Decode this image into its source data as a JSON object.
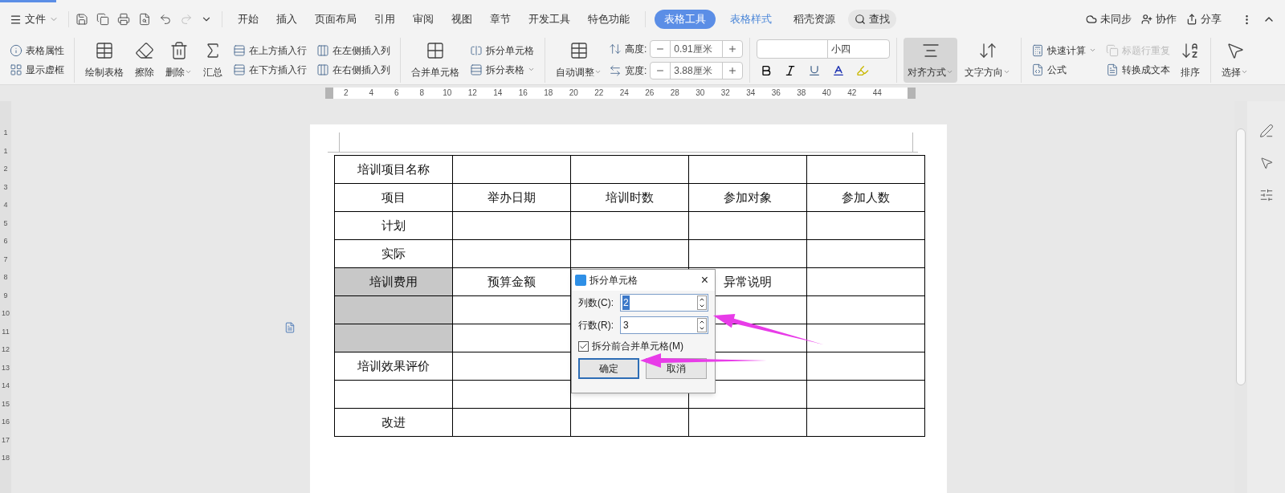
{
  "menu": {
    "file": "文件",
    "tabs": [
      {
        "label": "开始",
        "selected": false
      },
      {
        "label": "插入",
        "selected": false
      },
      {
        "label": "页面布局",
        "selected": false
      },
      {
        "label": "引用",
        "selected": false
      },
      {
        "label": "审阅",
        "selected": false
      },
      {
        "label": "视图",
        "selected": false
      },
      {
        "label": "章节",
        "selected": false
      },
      {
        "label": "开发工具",
        "selected": false
      },
      {
        "label": "特色功能",
        "selected": false
      }
    ],
    "context_tabs": [
      {
        "label": "表格工具",
        "selected": true
      },
      {
        "label": "表格样式",
        "selected": false
      }
    ],
    "extra_tab": "稻壳资源",
    "search": "查找",
    "sync": "未同步",
    "collab": "协作",
    "share": "分享"
  },
  "ribbon": {
    "table_props": "表格属性",
    "show_grid": "显示虚框",
    "draw_table": "绘制表格",
    "erase": "擦除",
    "delete": "删除",
    "summary": "汇总",
    "insert_above": "在上方插入行",
    "insert_below": "在下方插入行",
    "insert_left": "在左侧插入列",
    "insert_right": "在右侧插入列",
    "merge": "合并单元格",
    "split_cells": "拆分单元格",
    "split_table": "拆分表格",
    "autofit": "自动调整",
    "height_label": "高度:",
    "height_value": "0.91厘米",
    "width_label": "宽度:",
    "width_value": "3.88厘米",
    "font_size": "小四",
    "align": "对齐方式",
    "text_dir": "文字方向",
    "quick_calc": "快速计算",
    "header_repeat": {
      "label": "标题行重复",
      "disabled": true
    },
    "formula": "公式",
    "to_text": "转换成文本",
    "sort": "排序",
    "select": "选择"
  },
  "ruler": {
    "horizontal": [
      "2",
      "4",
      "6",
      "8",
      "10",
      "12",
      "14",
      "16",
      "18",
      "20",
      "22",
      "24",
      "26",
      "28",
      "30",
      "32",
      "34",
      "36",
      "38",
      "40",
      "42",
      "44"
    ],
    "vertical": [
      "1",
      "1",
      "2",
      "3",
      "4",
      "5",
      "6",
      "7",
      "8",
      "9",
      "10",
      "11",
      "12",
      "13",
      "14",
      "15",
      "16",
      "17",
      "18"
    ]
  },
  "table": {
    "rows": [
      {
        "cells": [
          "培训项目名称",
          "",
          "",
          "",
          ""
        ],
        "first_selected": false
      },
      {
        "cells": [
          "项目",
          "举办日期",
          "培训时数",
          "参加对象",
          "参加人数"
        ],
        "first_selected": false
      },
      {
        "cells": [
          "计划",
          "",
          "",
          "",
          ""
        ],
        "first_selected": false
      },
      {
        "cells": [
          "实际",
          "",
          "",
          "",
          ""
        ],
        "first_selected": false
      },
      {
        "cells": [
          "培训费用",
          "预算金额",
          "",
          "异常说明",
          ""
        ],
        "first_selected": true
      },
      {
        "cells": [
          "",
          "",
          "",
          "",
          ""
        ],
        "first_selected": true
      },
      {
        "cells": [
          "",
          "",
          "",
          "",
          ""
        ],
        "first_selected": true
      },
      {
        "cells": [
          "培训效果评价",
          "",
          "",
          "",
          ""
        ],
        "first_selected": false
      },
      {
        "cells": [
          "",
          "",
          "",
          "",
          ""
        ],
        "first_selected": false
      },
      {
        "cells": [
          "改进",
          "",
          "",
          "",
          ""
        ],
        "first_selected": false
      }
    ]
  },
  "dialog": {
    "title": "拆分单元格",
    "close": "×",
    "fields": [
      {
        "label": "列数(C):",
        "value": "2",
        "selected": true
      },
      {
        "label": "行数(R):",
        "value": "3",
        "selected": false
      }
    ],
    "checkbox": {
      "label": "拆分前合并单元格(M)",
      "checked": true
    },
    "buttons": [
      {
        "label": "确定",
        "default": true
      },
      {
        "label": "取消",
        "default": false
      }
    ]
  }
}
